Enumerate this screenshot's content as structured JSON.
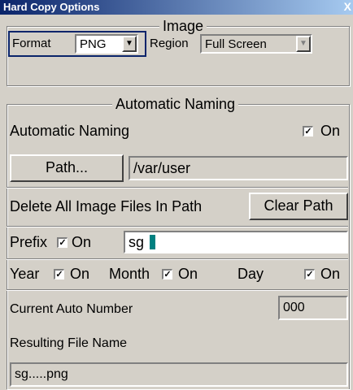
{
  "window": {
    "title": "Hard Copy Options",
    "close_glyph": "X"
  },
  "image_group": {
    "legend": "Image",
    "format_label": "Format",
    "format_value": "PNG",
    "region_label": "Region",
    "region_value": "Full Screen"
  },
  "naming_group": {
    "legend": "Automatic Naming",
    "auto_naming_label": "Automatic Naming",
    "auto_naming_on": "On",
    "path_button": "Path...",
    "path_value": "/var/user",
    "delete_label": "Delete All Image Files In Path",
    "clear_path_button": "Clear Path",
    "prefix_label": "Prefix",
    "prefix_on": "On",
    "prefix_value": "sg",
    "year_label": "Year",
    "year_on": "On",
    "month_label": "Month",
    "month_on": "On",
    "day_label": "Day",
    "day_on": "On",
    "counter_label": "Current Auto Number",
    "counter_value": "000",
    "result_label": "Resulting File Name",
    "result_value": "sg.....png"
  },
  "colors": {
    "accent": "#0a246a",
    "caret": "#008080",
    "face": "#d4d0c8"
  }
}
